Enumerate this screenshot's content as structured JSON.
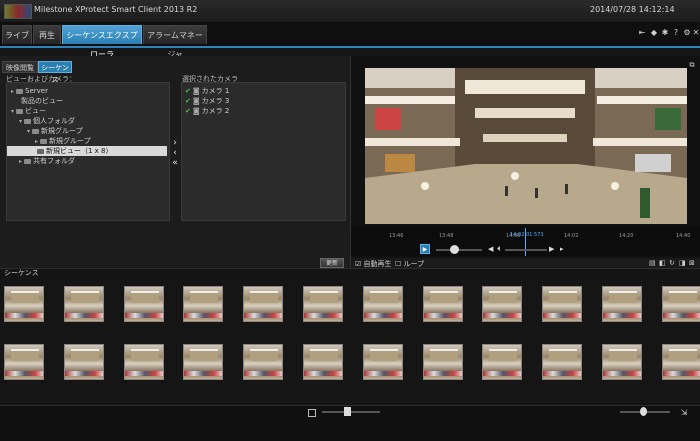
{
  "app": {
    "title": "Milestone XProtect Smart Client 2013 R2",
    "clock": "2014/07/28 14:12:14"
  },
  "tabs": [
    {
      "label": "ライブ"
    },
    {
      "label": "再生"
    },
    {
      "label": "シーケンスエクスプローラ"
    },
    {
      "label": "アラームマネージャ"
    }
  ],
  "toolbar_icons": [
    "arrow-icon",
    "signal-icon",
    "gear-icon",
    "help-icon",
    "settings-icon",
    "close-icon"
  ],
  "left": {
    "subtabs": [
      "映像閲覧",
      "シーケンス"
    ],
    "views_label": "ビューおよびカメラ：",
    "selected_label": "選択されたカメラ",
    "tree": [
      {
        "label": "Server",
        "indent": 1,
        "arrow": "▸"
      },
      {
        "label": "製品のビュー",
        "indent": 2,
        "arrow": ""
      },
      {
        "label": "ビュー",
        "indent": 1,
        "arrow": "▾"
      },
      {
        "label": "個人フォルダ",
        "indent": 2,
        "arrow": "▾"
      },
      {
        "label": "新規グループ",
        "indent": 3,
        "arrow": "▾"
      },
      {
        "label": "新規グループ",
        "indent": 4,
        "arrow": "▸"
      },
      {
        "label": "新規ビュー（1 x 8）",
        "indent": 4,
        "arrow": "",
        "selected": true
      },
      {
        "label": "共有フォルダ",
        "indent": 2,
        "arrow": "▸"
      }
    ],
    "selected_cameras": [
      "カメラ 1",
      "カメラ 3",
      "カメラ 2"
    ],
    "update_button": "更新"
  },
  "right": {
    "timeline_ticks": [
      "13:46",
      "13:48",
      "14:00",
      "14:02",
      "14:20",
      "14:40"
    ],
    "current_time": "14:02:01.573",
    "options": {
      "auto_play": "自動再生",
      "loop": "ループ"
    }
  },
  "sequence": {
    "label": "シーケンス",
    "rows": 2,
    "columns": 12
  }
}
